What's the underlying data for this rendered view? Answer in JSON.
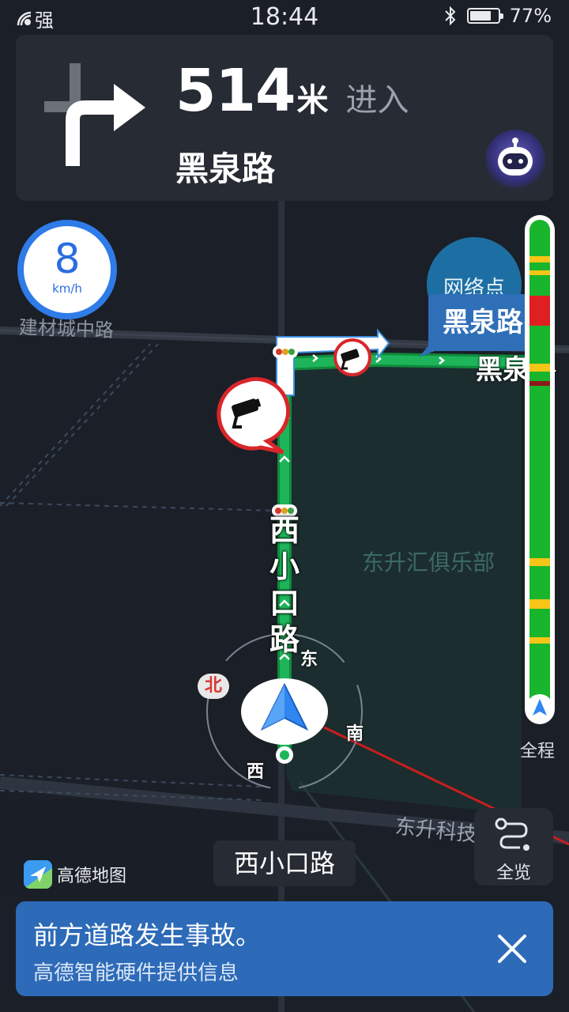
{
  "status_bar": {
    "signal_label": "强",
    "time": "18:44",
    "battery_percent": "77%",
    "battery_level": 0.77
  },
  "guidance": {
    "distance_value": "514",
    "distance_unit": "米",
    "action": "进入",
    "next_road": "黑泉路",
    "maneuver_icon": "turn-right-arrow-icon"
  },
  "speed": {
    "value": "8",
    "unit": "km/h"
  },
  "map": {
    "labels": {
      "road_top": "建材城中路",
      "network_point": "网络点",
      "destination_tag": "黑泉路",
      "destination_road": "黑泉路",
      "current_vertical_road": [
        "西",
        "小",
        "口",
        "路"
      ],
      "poi": "东升汇俱乐部",
      "road_bottom": "东升科技"
    },
    "compass": {
      "north": "北",
      "east": "东",
      "south": "南",
      "west": "西"
    }
  },
  "traffic_bar": {
    "label": "全程",
    "colors": {
      "smooth": "#19b52c",
      "slow": "#f5c518",
      "congested": "#e02020",
      "severe": "#8b1a1a"
    }
  },
  "controls": {
    "overview_label": "全览",
    "current_road": "西小口路"
  },
  "brand": {
    "name": "高德地图"
  },
  "notification": {
    "title": "前方道路发生事故。",
    "subtitle": "高德智能硬件提供信息"
  }
}
